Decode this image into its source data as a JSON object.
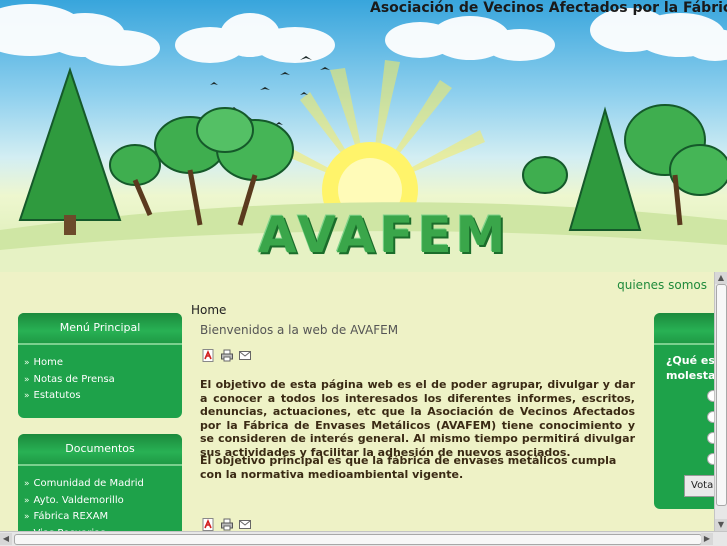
{
  "header": {
    "site_title": "Asociación de Vecinos Afectados por la Fábrica de",
    "logo_text": "AVAFEM"
  },
  "top_nav": {
    "link": "quienes somos"
  },
  "breadcrumb": "Home",
  "menu_principal": {
    "title": "Menú Principal",
    "items": [
      "Home",
      "Notas de Prensa",
      "Estatutos"
    ]
  },
  "documentos": {
    "title": "Documentos",
    "items": [
      "Comunidad de Madrid",
      "Ayto. Valdemorillo",
      "Fábrica REXAM",
      "Vias Pecuarias"
    ]
  },
  "poll": {
    "question_line1": "¿Qué es",
    "question_line2": "molesta",
    "vote_label": "Votar"
  },
  "article": {
    "title": "Bienvenidos a la web de AVAFEM",
    "paragraph1": "El objetivo de esta página web es el de poder agrupar, divulgar y dar a conocer a todos los interesados los diferentes informes, escritos, denuncias, actuaciones, etc que la Asociación de Vecinos Afectados por la Fábrica de Envases Metálicos (AVAFEM) tiene conocimiento y se consideren de interés general. Al mismo tiempo permitirá divulgar sus actividades y facilitar la adhesión de nuevos asociados.",
    "paragraph2": "El objetivo principal es que la fábrica de envases metálicos cumpla con la normativa medioambiental vigente."
  },
  "icons": [
    "pdf-icon",
    "print-icon",
    "email-icon"
  ],
  "colors": {
    "background": "#eef2c6",
    "box_green": "#1ea24a",
    "logo_green": "#3aa64a",
    "link_green": "#1f8a3b"
  }
}
